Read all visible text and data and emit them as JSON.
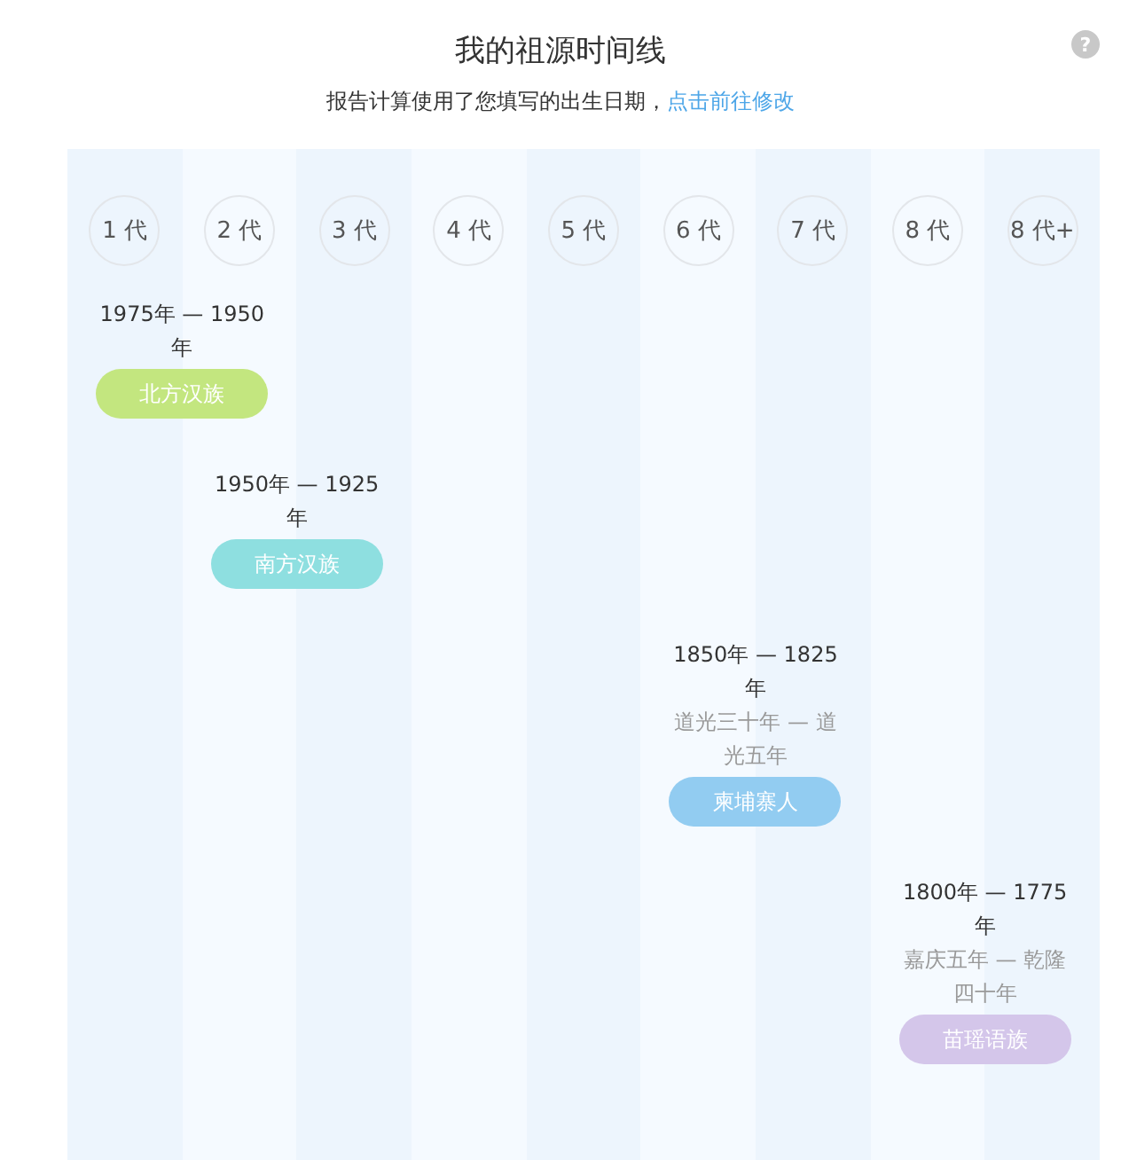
{
  "title": "我的祖源时间线",
  "subtitle": {
    "text": "报告计算使用了您填写的出生日期，",
    "link": "点击前往修改"
  },
  "help": "?",
  "generations": [
    {
      "label": "1 代",
      "lineage": {
        "years": "1975年 — 1950年",
        "name": "北方汉族",
        "color": "#c3e67f"
      }
    },
    {
      "label": "2 代",
      "lineage": {
        "years": "1950年 — 1925年",
        "name": "南方汉族",
        "color": "#8edfe0"
      }
    },
    {
      "label": "3 代"
    },
    {
      "label": "4 代"
    },
    {
      "label": "5 代"
    },
    {
      "label": "6 代",
      "lineage": {
        "years": "1850年 — 1825年",
        "era": "道光三十年 — 道光五年",
        "name": "柬埔寨人",
        "color": "#92ccf1"
      }
    },
    {
      "label": "7 代"
    },
    {
      "label": "8 代",
      "lineage": {
        "years": "1800年 — 1775年",
        "era": "嘉庆五年 — 乾隆四十年",
        "name": "苗瑶语族",
        "color": "#d4c6ea"
      }
    },
    {
      "label": "8 代+"
    }
  ]
}
